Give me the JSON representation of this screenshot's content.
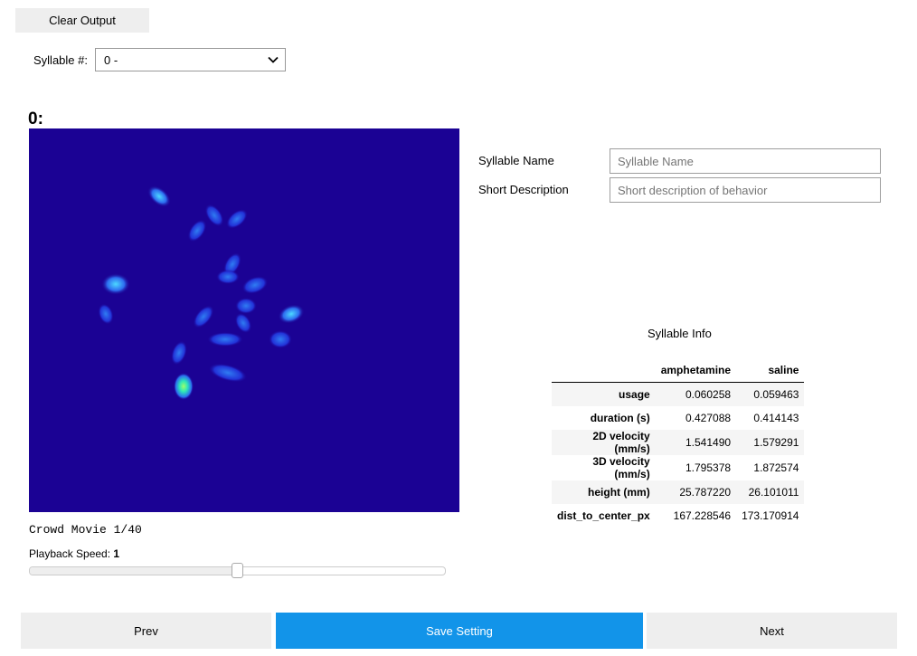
{
  "toolbar": {
    "clear_output_label": "Clear Output"
  },
  "syllable_selector": {
    "label": "Syllable #:",
    "selected": "0 -"
  },
  "heading": "0:",
  "movie": {
    "caption": "Crowd Movie 1/40",
    "background_color": "#1b0294"
  },
  "playback": {
    "label": "Playback Speed:",
    "value": "1",
    "slider_fraction": 0.5
  },
  "form": {
    "name_label": "Syllable Name",
    "name_placeholder": "Syllable Name",
    "desc_label": "Short Description",
    "desc_placeholder": "Short description of behavior"
  },
  "syllable_info": {
    "title": "Syllable Info",
    "columns": [
      "amphetamine",
      "saline"
    ],
    "rows": [
      {
        "label": "usage",
        "values": [
          "0.060258",
          "0.059463"
        ]
      },
      {
        "label": "duration (s)",
        "values": [
          "0.427088",
          "0.414143"
        ]
      },
      {
        "label": "2D velocity (mm/s)",
        "values": [
          "1.541490",
          "1.579291"
        ]
      },
      {
        "label": "3D velocity (mm/s)",
        "values": [
          "1.795378",
          "1.872574"
        ]
      },
      {
        "label": "height (mm)",
        "values": [
          "25.787220",
          "26.101011"
        ]
      },
      {
        "label": "dist_to_center_px",
        "values": [
          "167.228546",
          "173.170914"
        ]
      }
    ]
  },
  "nav": {
    "prev_label": "Prev",
    "save_label": "Save Setting",
    "next_label": "Next"
  },
  "colors": {
    "accent": "#1294e9",
    "button_gray": "#eeeeee"
  }
}
